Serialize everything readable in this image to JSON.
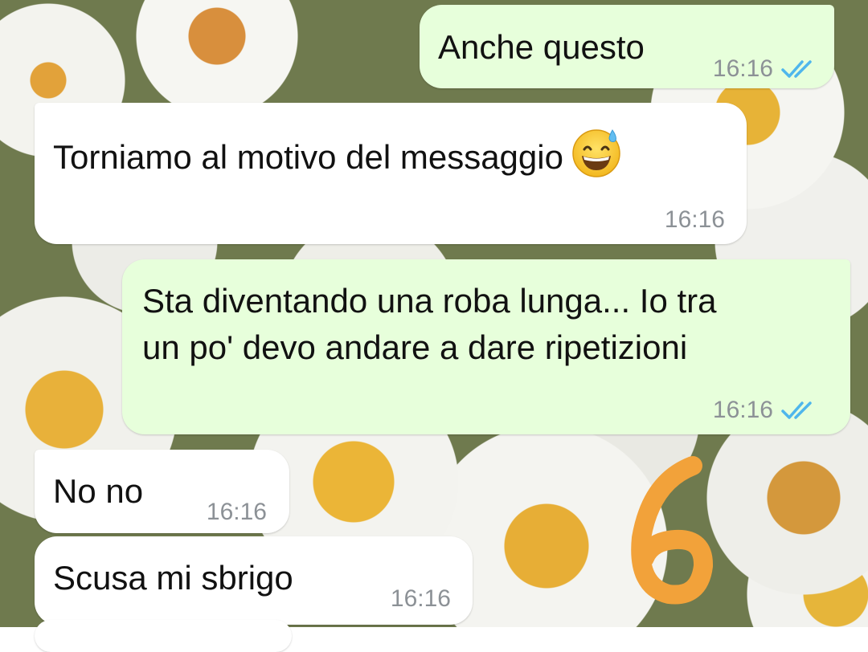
{
  "messages": [
    {
      "id": "m1",
      "direction": "outgoing",
      "text": "Anche questo",
      "time": "16:16",
      "status": "read"
    },
    {
      "id": "m2",
      "direction": "incoming",
      "text": "Torniamo al motivo del messaggio",
      "emoji": "grinning-face-with-sweat",
      "time": "16:16"
    },
    {
      "id": "m3",
      "direction": "outgoing",
      "text_line1": "Sta diventando una roba lunga... Io tra",
      "text_line2": "un po' devo andare a dare ripetizioni",
      "time": "16:16",
      "status": "read"
    },
    {
      "id": "m4",
      "direction": "incoming",
      "text": "No no",
      "time": "16:16"
    },
    {
      "id": "m5",
      "direction": "incoming",
      "text": "Scusa mi sbrigo",
      "time": "16:16"
    }
  ],
  "annotation": {
    "text": "6",
    "color": "#f2a23a"
  },
  "colors": {
    "outgoing_bubble": "#e7ffdb",
    "incoming_bubble": "#ffffff",
    "read_ticks": "#4fb6ec",
    "timestamp": "#8c9196"
  }
}
